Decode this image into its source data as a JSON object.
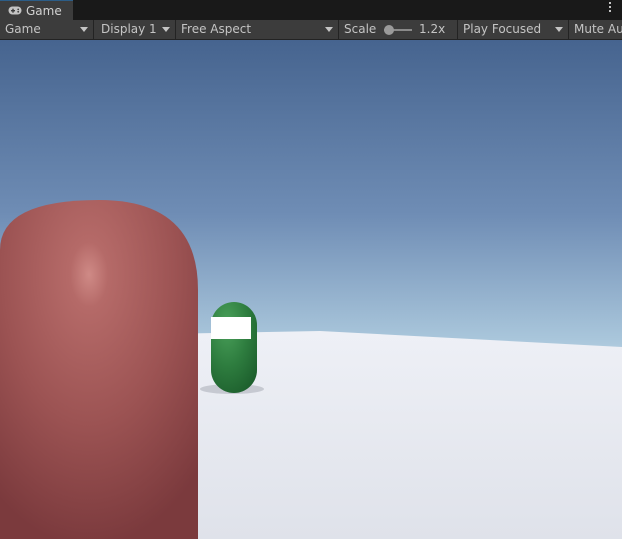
{
  "tab": {
    "label": "Game",
    "icon": "gamepad-icon"
  },
  "toolbar": {
    "view_mode": "Game",
    "display": "Display 1",
    "aspect": "Free Aspect",
    "scale_label": "Scale",
    "scale_value": "1.2x",
    "play_mode": "Play Focused",
    "mute_audio": "Mute Au"
  },
  "scene": {
    "sky_top": "#4b6a98",
    "sky_horizon": "#d8eaf3",
    "ground": "#e4e7ef",
    "red_capsule": "#a65858",
    "green_capsule": "#2e7d3f"
  }
}
